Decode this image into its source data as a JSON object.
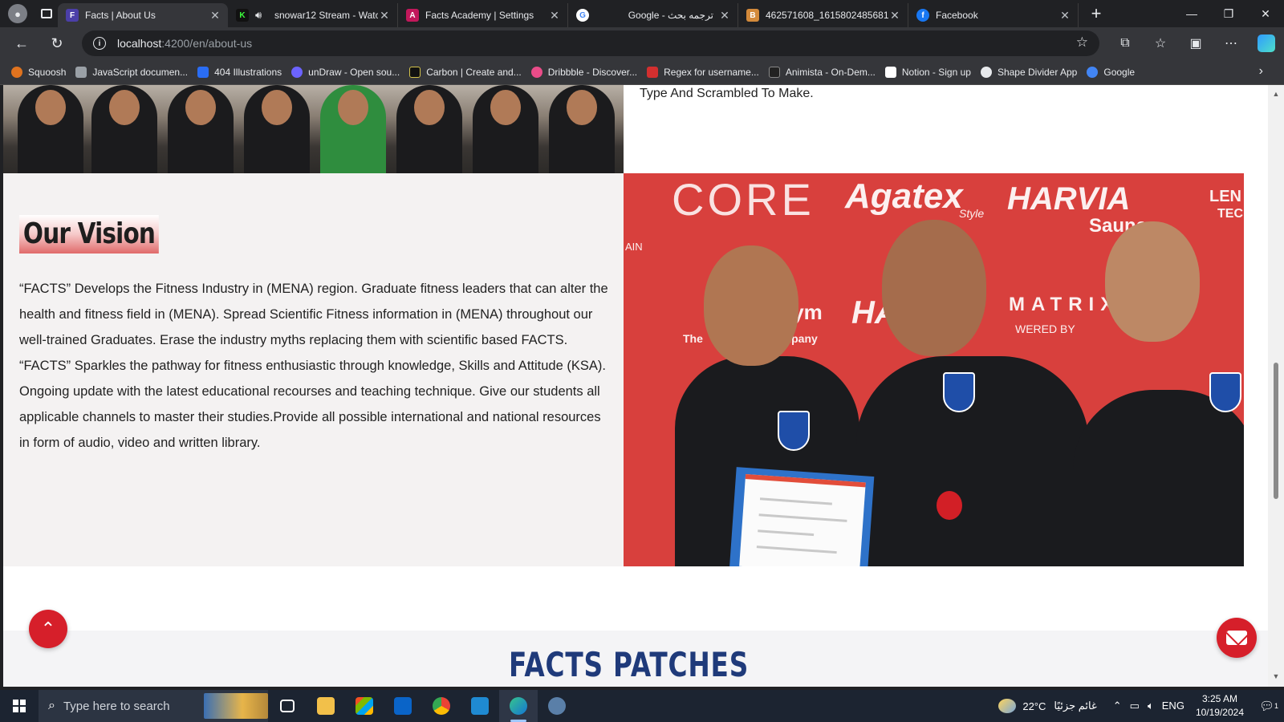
{
  "browser": {
    "tabs": [
      {
        "title": "Facts | About Us",
        "favicon_color": "#4b3fa8",
        "favicon_letter": "F"
      },
      {
        "title": "snowar12 Stream - Watc",
        "favicon_color": "#1a1a1a",
        "favicon_letter": "K"
      },
      {
        "title": "Facts Academy | Settings",
        "favicon_color": "#c2185b",
        "favicon_letter": "A"
      },
      {
        "title": "Google - ترجمه بحث",
        "favicon_color": "#ffffff",
        "favicon_letter": "G"
      },
      {
        "title": "462571608_1615802485681",
        "favicon_color": "#d38a3b",
        "favicon_letter": "B"
      },
      {
        "title": "Facebook",
        "favicon_color": "#1877f2",
        "favicon_letter": "f"
      }
    ],
    "new_tab_label": "+",
    "url_host": "localhost",
    "url_path": ":4200/en/about-us",
    "bookmarks": [
      {
        "label": "Squoosh",
        "color": "#e0731f"
      },
      {
        "label": "JavaScript documen...",
        "color": "#9aa0a6"
      },
      {
        "label": "404 Illustrations",
        "color": "#2a6df4"
      },
      {
        "label": "unDraw - Open sou...",
        "color": "#6c63ff"
      },
      {
        "label": "Carbon | Create and...",
        "color": "#111111"
      },
      {
        "label": "Dribbble - Discover...",
        "color": "#ea4c89"
      },
      {
        "label": "Regex for username...",
        "color": "#d32f2f"
      },
      {
        "label": "Animista - On-Dem...",
        "color": "#222222"
      },
      {
        "label": "Notion - Sign up",
        "color": "#ffffff"
      },
      {
        "label": "Shape Divider App",
        "color": "#e8eaed"
      },
      {
        "label": "Google",
        "color": "#4285f4"
      }
    ]
  },
  "page": {
    "top_text": "Type And Scrambled To Make.",
    "vision_title": "Our Vision",
    "vision_body": "“FACTS” Develops the Fitness Industry in (MENA) region. Graduate fitness leaders that can alter the health and fitness field in (MENA). Spread Scientific Fitness information in (MENA) throughout our well-trained Graduates. Erase the industry myths replacing them with scientific based FACTS. “FACTS” Sparkles the pathway for fitness enthusiastic through knowledge, Skills and Attitude (KSA). Ongoing update with the latest educational recourses and teaching technique. Give our students all applicable channels to master their studies.Provide all possible international and national resources in form of audio, video and written library.",
    "photo_sponsors": [
      "CORE",
      "Agatex",
      "HARVIA",
      "Sauna",
      "MATRIX",
      "Gym",
      "The",
      "Company",
      "HA",
      "WERED BY",
      "AIN",
      "LEN",
      "TEC",
      "Style"
    ],
    "patches_title": "FACTS PATCHES",
    "accent_color": "#d61f2a"
  },
  "taskbar": {
    "search_placeholder": "Type here to search",
    "weather_temp": "22°C",
    "weather_desc": "غائم جزئيًا",
    "language": "ENG",
    "time": "3:25 AM",
    "date": "10/19/2024",
    "notification_count": "1"
  }
}
